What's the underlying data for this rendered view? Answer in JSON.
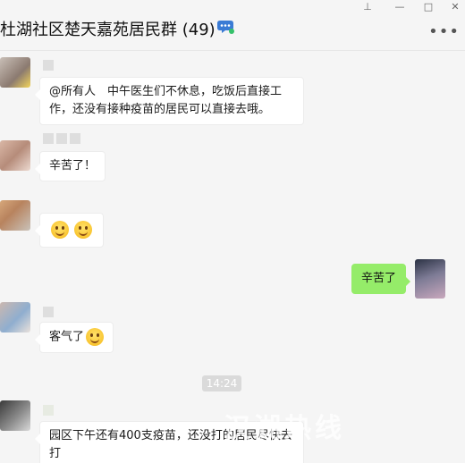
{
  "window": {
    "title": "杜湖社区楚天嘉苑居民群 (49)",
    "controls": [
      "pin-icon",
      "minimize-icon",
      "maximize-icon",
      "close-icon"
    ],
    "more_glyph": "•••"
  },
  "messages": [
    {
      "side": "left",
      "text": "@所有人　中午医生们不休息，吃饭后直接工作，还没有接种疫苗的居民可以直接去哦。"
    },
    {
      "side": "left",
      "text": "辛苦了！"
    },
    {
      "side": "left",
      "emojis": [
        "smile-emoji",
        "smile-emoji"
      ]
    },
    {
      "side": "right",
      "text": "辛苦了"
    },
    {
      "side": "left",
      "text": "客气了"
    },
    {
      "side": "left",
      "text": "园区下午还有400支疫苗，还没打的居民尽快去打"
    }
  ],
  "timestamp": "14:24",
  "watermark": "汉湖热线",
  "colors": {
    "mine_bubble": "#95ec69",
    "other_bubble": "#ffffff",
    "background": "#f5f5f5",
    "badge": "#3a7bd5"
  }
}
